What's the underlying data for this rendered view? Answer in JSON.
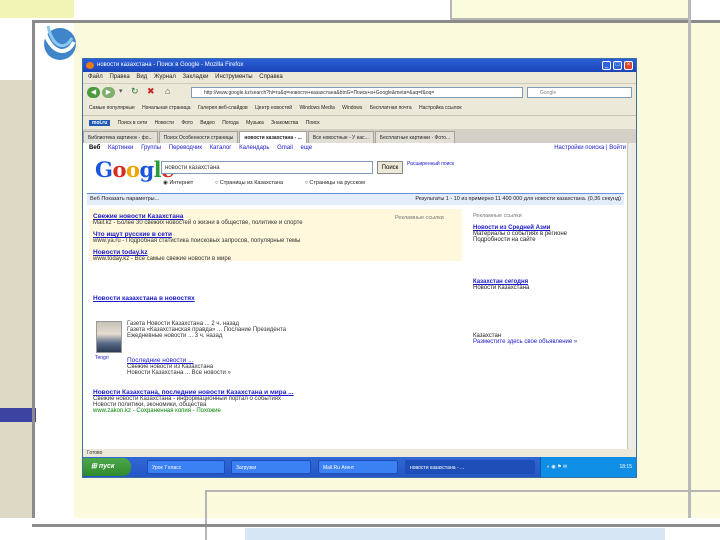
{
  "window": {
    "title": "новости казахстана - Поиск в Google - Mozilla Firefox"
  },
  "menu": [
    "Файл",
    "Правка",
    "Вид",
    "Журнал",
    "Закладки",
    "Инструменты",
    "Справка"
  ],
  "address": {
    "url": "http://www.google.kz/search?hl=ru&q=новости+казахстана&btnG=Поиск+в+Google&meta=&aq=f&oq=",
    "search_placeholder": "Google"
  },
  "bookmarks_row1": [
    "Самые популярные",
    "Начальная страница",
    "Галерея веб-слайдов",
    "Центр новостей",
    "Windows Media",
    "Windows",
    "Бесплатная почта",
    "Настройка ссылок"
  ],
  "bookmarks_row2": [
    "moi.ru",
    "Поиск в сети",
    "Новости",
    "Фото",
    "Видео",
    "Погода",
    "Музыка",
    "Знакомства",
    "Поиск"
  ],
  "tabs": [
    "Библиотека картинок - фо...",
    "Поиск Особенности страницы",
    "новости казахстана - ...",
    "Все новостные - У нас...",
    "Бесплатные картинки - Фото..."
  ],
  "active_tab_index": 2,
  "google_bar": {
    "links": [
      "Веб",
      "Картинки",
      "Группы",
      "Переводчик",
      "Каталог",
      "Календарь",
      "Gmail",
      "еще"
    ],
    "right": "Настройки поиска | Войти"
  },
  "search": {
    "logo": "Google",
    "query": "новости казахстана",
    "button": "Поиск",
    "advanced": "Расширенный поиск",
    "radios": [
      "Интернет",
      "Страницы из Казахстана",
      "Страницы на русском"
    ]
  },
  "results_bar": {
    "left": "Веб  Показать параметры...",
    "right": "Результаты 1 - 10 из примерно 11 400 000 для новости казахстана. (0,36 секунд)"
  },
  "ads": [
    {
      "title": "Свежие новости Казахстана",
      "line": "Mail.kz - Более 30 свежих новостей о жизни в обществе, политике и спорте",
      "label": "Рекламные ссылки"
    },
    {
      "title": "Что ищут русские в сети",
      "line": "www.ya.ru - Подробная статистика поисковых запросов, популярные темы"
    },
    {
      "title": "Новости today.kz",
      "line": "www.today.kz - Все самые свежие новости в мире"
    }
  ],
  "results": [
    {
      "title": "Новости казахстана в новостях",
      "lines": [
        "Газета Новости Казахстана ... 2 ч. назад",
        "Газета «Казахстанская правда» ... Послание Президента",
        "Ежедневные новости ... 3 ч. назад"
      ],
      "thumb_caption": "Tengri"
    },
    {
      "title": "Последние новости ...",
      "lines": [
        "Свежие новости из Казахстана",
        "Новости Казахстана ... Все новости »"
      ]
    },
    {
      "title": "Новости Казахстана, последние новости Казахстана и мира ...",
      "lines": [
        "Свежие новости Казахстана - информационный портал о событиях",
        "Новости политики, экономики, общества"
      ],
      "url": "www.zakon.kz - Сохраненная копия - Похожие"
    }
  ],
  "sidebar": [
    {
      "title": "Новости из Средней Азии",
      "lines": [
        "Материалы о событиях в регионе",
        "Подробности на сайте"
      ],
      "label": "Рекламные ссылки"
    },
    {
      "title": "Казахстан сегодня",
      "lines": [
        "Новости Казахстана"
      ]
    },
    {
      "title": "Казахстан",
      "lines": [
        "Разместите здесь свое объявление »"
      ]
    }
  ],
  "status": "Готово",
  "taskbar": {
    "start": "пуск",
    "items": [
      "Урок 7 класс",
      "Загрузки",
      "Mail.Ru Агент",
      "новости казахстана - ..."
    ],
    "time": "18:15"
  }
}
